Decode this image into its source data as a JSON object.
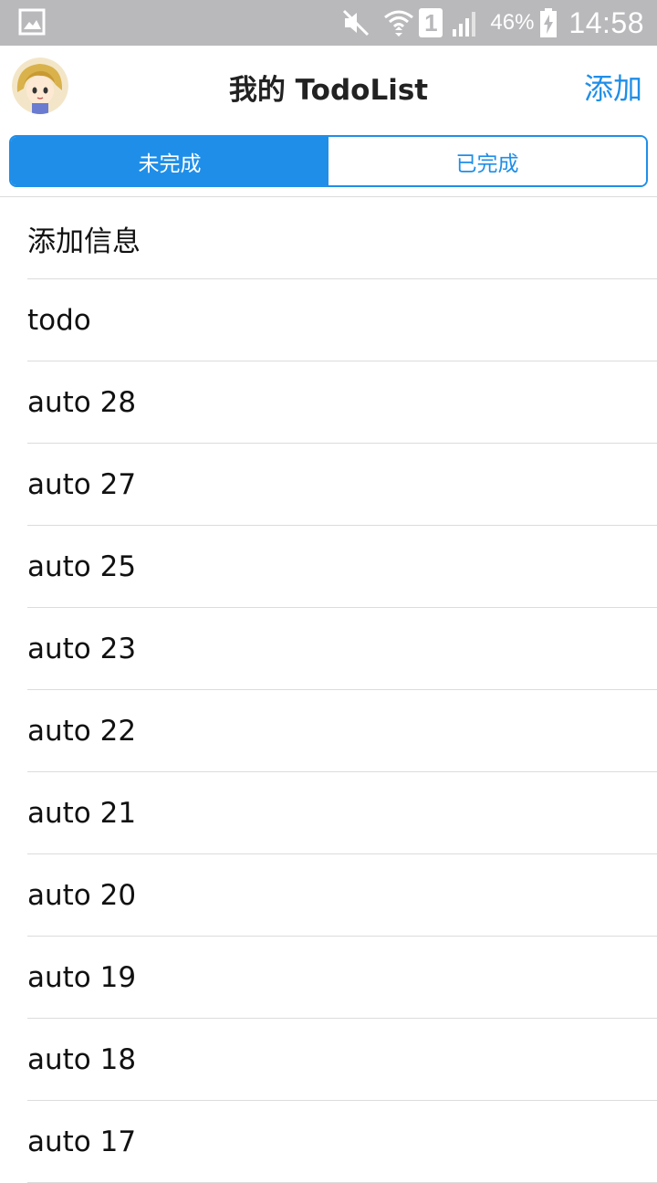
{
  "status_bar": {
    "icons": [
      "gallery-icon",
      "mute-icon",
      "wifi-icon",
      "sim-icon",
      "signal-icon",
      "battery-icon"
    ],
    "sim_number": "1",
    "battery_percent": "46%",
    "time": "14:58"
  },
  "header": {
    "title": "我的 TodoList",
    "add_label": "添加"
  },
  "tabs": [
    {
      "label": "未完成",
      "active": true
    },
    {
      "label": "已完成",
      "active": false
    }
  ],
  "todos": [
    "添加信息",
    "todo",
    "auto 28",
    "auto 27",
    "auto 25",
    "auto 23",
    "auto 22",
    "auto 21",
    "auto 20",
    "auto 19",
    "auto 18",
    "auto 17"
  ],
  "colors": {
    "accent": "#1f8ee8",
    "status_bar": "#b9b9bc"
  }
}
